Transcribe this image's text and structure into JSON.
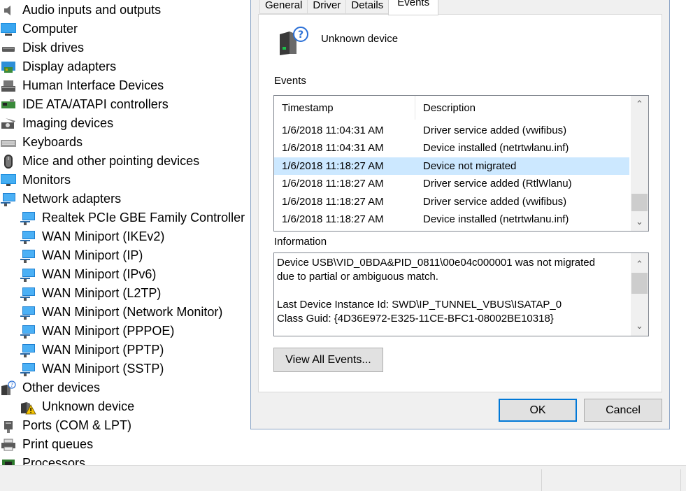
{
  "tree": {
    "items": [
      {
        "label": "Audio inputs and outputs",
        "icon": "speaker-icon",
        "level": 0
      },
      {
        "label": "Computer",
        "icon": "computer-icon",
        "level": 0
      },
      {
        "label": "Disk drives",
        "icon": "disk-drive-icon",
        "level": 0
      },
      {
        "label": "Display adapters",
        "icon": "display-adapter-icon",
        "level": 0
      },
      {
        "label": "Human Interface Devices",
        "icon": "hid-icon",
        "level": 0
      },
      {
        "label": "IDE ATA/ATAPI controllers",
        "icon": "ide-controller-icon",
        "level": 0
      },
      {
        "label": "Imaging devices",
        "icon": "camera-icon",
        "level": 0
      },
      {
        "label": "Keyboards",
        "icon": "keyboard-icon",
        "level": 0
      },
      {
        "label": "Mice and other pointing devices",
        "icon": "mouse-icon",
        "level": 0
      },
      {
        "label": "Monitors",
        "icon": "monitor-icon",
        "level": 0
      },
      {
        "label": "Network adapters",
        "icon": "network-adapter-icon",
        "level": 0
      },
      {
        "label": "Realtek PCIe GBE Family Controller",
        "icon": "network-adapter-icon",
        "level": 1
      },
      {
        "label": "WAN Miniport (IKEv2)",
        "icon": "network-adapter-icon",
        "level": 1
      },
      {
        "label": "WAN Miniport (IP)",
        "icon": "network-adapter-icon",
        "level": 1
      },
      {
        "label": "WAN Miniport (IPv6)",
        "icon": "network-adapter-icon",
        "level": 1
      },
      {
        "label": "WAN Miniport (L2TP)",
        "icon": "network-adapter-icon",
        "level": 1
      },
      {
        "label": "WAN Miniport (Network Monitor)",
        "icon": "network-adapter-icon",
        "level": 1
      },
      {
        "label": "WAN Miniport (PPPOE)",
        "icon": "network-adapter-icon",
        "level": 1
      },
      {
        "label": "WAN Miniport (PPTP)",
        "icon": "network-adapter-icon",
        "level": 1
      },
      {
        "label": "WAN Miniport (SSTP)",
        "icon": "network-adapter-icon",
        "level": 1
      },
      {
        "label": "Other devices",
        "icon": "unknown-device-icon",
        "level": 0
      },
      {
        "label": "Unknown device",
        "icon": "warning-device-icon",
        "level": 1
      },
      {
        "label": "Ports (COM & LPT)",
        "icon": "port-icon",
        "level": 0
      },
      {
        "label": "Print queues",
        "icon": "printer-icon",
        "level": 0
      },
      {
        "label": "Processors",
        "icon": "processor-icon",
        "level": 0
      }
    ]
  },
  "dialog": {
    "tabs": [
      "General",
      "Driver",
      "Details",
      "Events"
    ],
    "active_tab": "Events",
    "device_name": "Unknown device",
    "events_label": "Events",
    "columns": [
      "Timestamp",
      "Description"
    ],
    "events": [
      {
        "timestamp": "1/6/2018 11:04:31 AM",
        "description": "Driver service added (vwifibus)",
        "selected": false
      },
      {
        "timestamp": "1/6/2018 11:04:31 AM",
        "description": "Device installed (netrtwlanu.inf)",
        "selected": false
      },
      {
        "timestamp": "1/6/2018 11:18:27 AM",
        "description": "Device not migrated",
        "selected": true
      },
      {
        "timestamp": "1/6/2018 11:18:27 AM",
        "description": "Driver service added (RtlWlanu)",
        "selected": false
      },
      {
        "timestamp": "1/6/2018 11:18:27 AM",
        "description": "Driver service added (vwifibus)",
        "selected": false
      },
      {
        "timestamp": "1/6/2018 11:18:27 AM",
        "description": "Device installed (netrtwlanu.inf)",
        "selected": false
      }
    ],
    "information_label": "Information",
    "information_lines": [
      "Device USB\\VID_0BDA&PID_0811\\00e04c000001 was not migrated",
      "due to partial or ambiguous match.",
      "",
      "Last Device Instance Id: SWD\\IP_TUNNEL_VBUS\\ISATAP_0",
      "Class Guid: {4D36E972-E325-11CE-BFC1-08002BE10318}"
    ],
    "view_all_label": "View All Events...",
    "ok_label": "OK",
    "cancel_label": "Cancel"
  },
  "colors": {
    "selection": "#cce8ff",
    "default_button_border": "#0078d7",
    "dialog_background": "#f0f0f0"
  }
}
